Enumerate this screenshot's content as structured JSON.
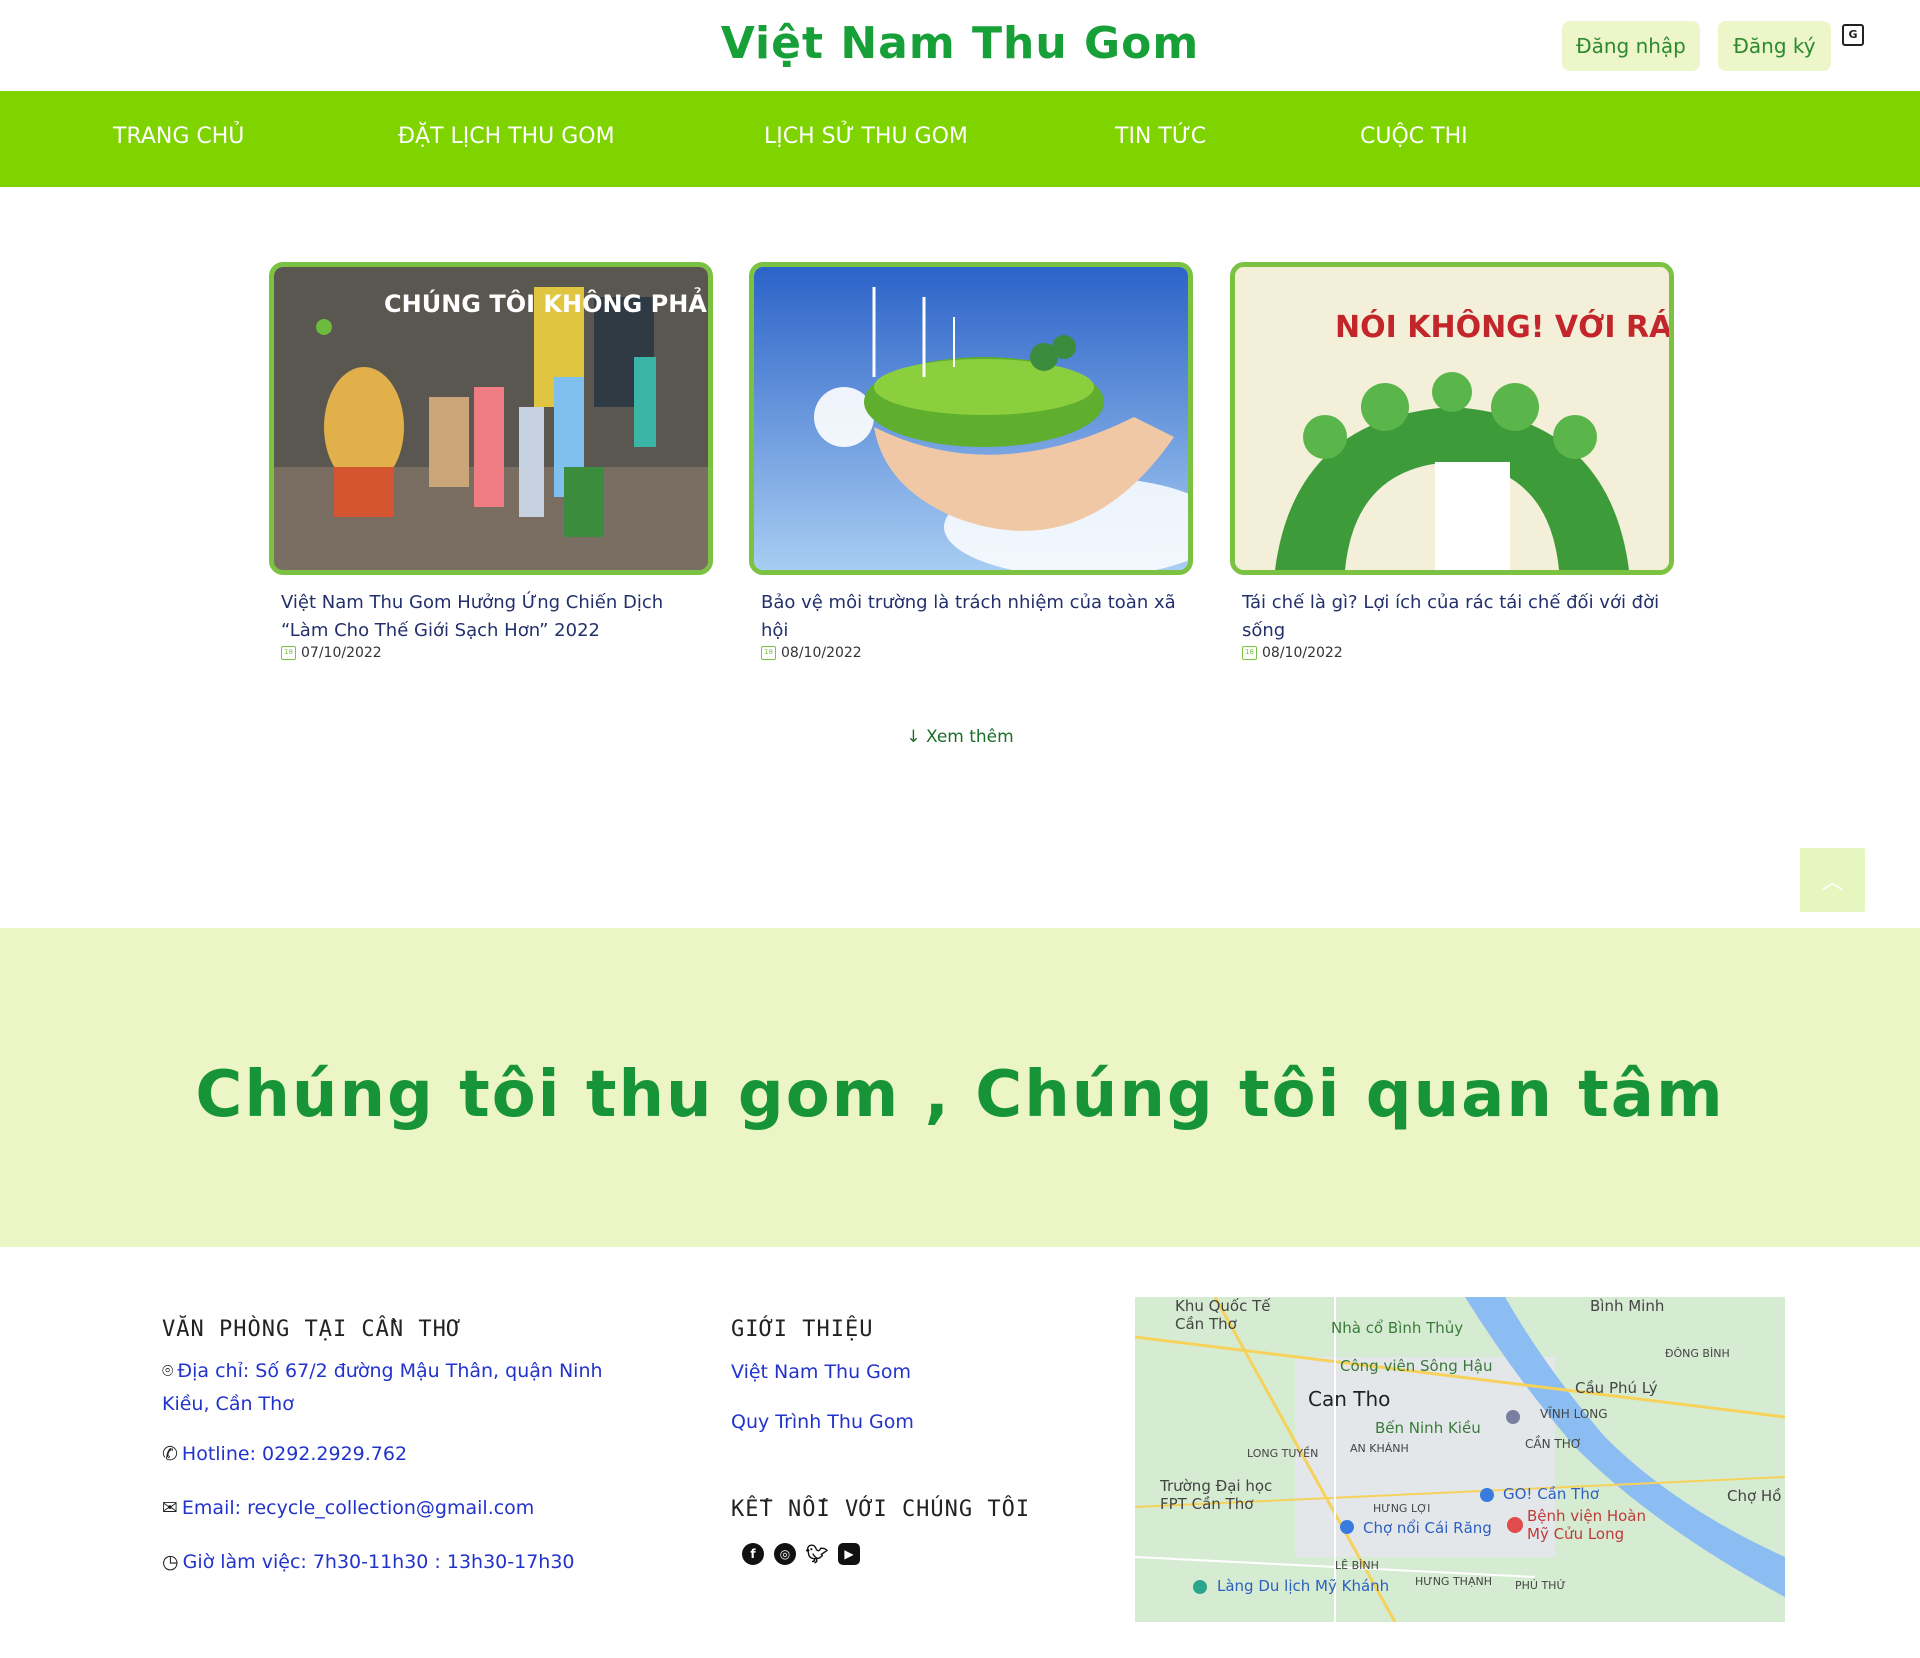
{
  "header": {
    "brand": "Việt Nam Thu Gom",
    "login_label": "Đăng nhập",
    "register_label": "Đăng ký"
  },
  "nav": {
    "items": [
      "TRANG CHỦ",
      "ĐẶT LỊCH THU GOM",
      "LỊCH SỬ THU GOM",
      "TIN TỨC",
      "CUỘC THI"
    ]
  },
  "news": {
    "cards": [
      {
        "image_text": "CHÚNG TÔI KHÔNG PHẢI LÀ RÁC",
        "title": "Việt Nam Thu Gom Hưởng Ứng Chiến Dịch “Làm Cho Thế Giới Sạch Hơn” 2022",
        "date": "07/10/2022"
      },
      {
        "image_text": "",
        "title": "Bảo vệ môi trường là trách nhiệm của toàn xã hội",
        "date": "08/10/2022"
      },
      {
        "image_text": "NÓI KHÔNG! VỚI RÁC THẢI NHỰA",
        "title": "Tái chế là gì? Lợi ích của rác tái chế đối với đời sống",
        "date": "08/10/2022"
      }
    ],
    "more_label": "Xem thêm",
    "more_arrow": "↓"
  },
  "slogan": "Chúng tôi thu gom , Chúng tôi quan tâm",
  "footer": {
    "office_heading": "VĂN PHÒNG TẠI CẦN THƠ",
    "address": "Địa chỉ: Số 67/2 đường Mậu Thân, quận Ninh Kiều, Cần Thơ",
    "hotline": "Hotline: 0292.2929.762",
    "email": "Email: recycle_collection@gmail.com",
    "hours": "Giờ làm việc: 7h30-11h30 : 13h30-17h30",
    "intro_heading": "GIỚI THIỆU",
    "intro_links": [
      "Việt Nam Thu Gom",
      "Quy Trình Thu Gom"
    ],
    "connect_heading": "KẾT NỐI VỚI CHÚNG TÔI",
    "social_icons": [
      "facebook-icon",
      "instagram-icon",
      "twitter-icon",
      "youtube-icon"
    ]
  },
  "map": {
    "labels": [
      "Can Tho",
      "Bình Minh",
      "Nhà cổ Bình Thủy",
      "Công viên Sông Hậu",
      "Cầu Phú Lý",
      "Bến Ninh Kiều",
      "VĨNH LONG",
      "CẦN THƠ",
      "LONG TUYỀN",
      "AN KHÁNH",
      "Trường Đại học FPT Cần Thơ",
      "GO! Cần Thơ",
      "Chợ nổi Cái Răng",
      "Bệnh viện Hoàn Mỹ Cửu Long",
      "Chợ Hồ",
      "HƯNG LỢI",
      "LÊ BÌNH",
      "HƯNG THẠNH",
      "PHÚ THỨ",
      "Làng Du lịch Mỹ Khánh",
      "ĐÔNG BÌNH",
      "Khu Quốc Tế Cần Thơ"
    ]
  },
  "colors": {
    "brand_green": "#17a038",
    "nav_green": "#7fd400",
    "band_bg": "#ecf5c6",
    "card_border": "#7cc242",
    "link_blue": "#2233cc"
  }
}
